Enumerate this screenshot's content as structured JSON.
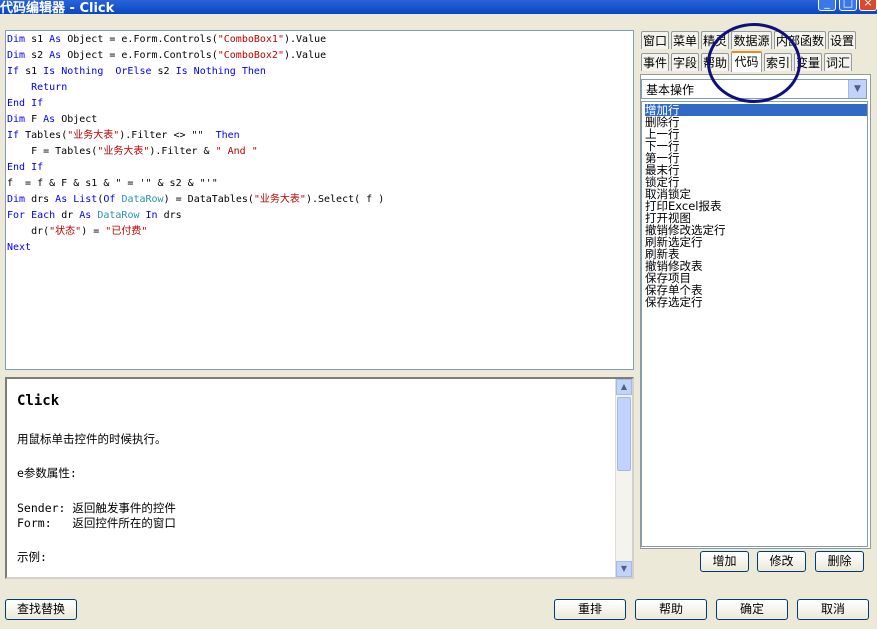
{
  "window": {
    "title": "代码编辑器 - Click",
    "min_glyph": "_",
    "max_glyph": "□",
    "close_glyph": "×"
  },
  "code_lines": [
    [
      {
        "t": "kw",
        "s": "Dim"
      },
      {
        "t": "tx",
        "s": " s1 "
      },
      {
        "t": "kw",
        "s": "As"
      },
      {
        "t": "tx",
        "s": " Object = e.Form.Controls("
      },
      {
        "t": "st",
        "s": "\"ComboBox1\""
      },
      {
        "t": "tx",
        "s": ").Value"
      }
    ],
    [
      {
        "t": "kw",
        "s": "Dim"
      },
      {
        "t": "tx",
        "s": " s2 "
      },
      {
        "t": "kw",
        "s": "As"
      },
      {
        "t": "tx",
        "s": " Object = e.Form.Controls("
      },
      {
        "t": "st",
        "s": "\"ComboBox2\""
      },
      {
        "t": "tx",
        "s": ").Value"
      }
    ],
    [
      {
        "t": "kw",
        "s": "If"
      },
      {
        "t": "tx",
        "s": " s1 "
      },
      {
        "t": "kw",
        "s": "Is Nothing  OrElse"
      },
      {
        "t": "tx",
        "s": " s2 "
      },
      {
        "t": "kw",
        "s": "Is Nothing Then"
      }
    ],
    [
      {
        "t": "tx",
        "s": "    "
      },
      {
        "t": "kw",
        "s": "Return"
      }
    ],
    [
      {
        "t": "kw",
        "s": "End If"
      }
    ],
    [
      {
        "t": "kw",
        "s": "Dim"
      },
      {
        "t": "tx",
        "s": " F "
      },
      {
        "t": "kw",
        "s": "As"
      },
      {
        "t": "tx",
        "s": " Object"
      }
    ],
    [
      {
        "t": "kw",
        "s": "If"
      },
      {
        "t": "tx",
        "s": " Tables("
      },
      {
        "t": "st",
        "s": "\"业务大表\""
      },
      {
        "t": "tx",
        "s": ").Filter <> \"\"  "
      },
      {
        "t": "kw",
        "s": "Then"
      }
    ],
    [
      {
        "t": "tx",
        "s": "    F = Tables("
      },
      {
        "t": "st",
        "s": "\"业务大表\""
      },
      {
        "t": "tx",
        "s": ").Filter & "
      },
      {
        "t": "st",
        "s": "\" And \""
      }
    ],
    [
      {
        "t": "kw",
        "s": "End If"
      }
    ],
    [
      {
        "t": "tx",
        "s": "f  = f & F & s1 & \" = '\" & s2 & \"'\""
      }
    ],
    [
      {
        "t": "kw",
        "s": "Dim"
      },
      {
        "t": "tx",
        "s": " drs "
      },
      {
        "t": "kw",
        "s": "As List"
      },
      {
        "t": "tx",
        "s": "("
      },
      {
        "t": "kw",
        "s": "Of"
      },
      {
        "t": "tx",
        "s": " "
      },
      {
        "t": "ty",
        "s": "DataRow"
      },
      {
        "t": "tx",
        "s": ") = DataTables("
      },
      {
        "t": "st",
        "s": "\"业务大表\""
      },
      {
        "t": "tx",
        "s": ").Select( f )"
      }
    ],
    [
      {
        "t": "kw",
        "s": "For Each"
      },
      {
        "t": "tx",
        "s": " dr "
      },
      {
        "t": "kw",
        "s": "As"
      },
      {
        "t": "tx",
        "s": " "
      },
      {
        "t": "ty",
        "s": "DataRow"
      },
      {
        "t": "tx",
        "s": " "
      },
      {
        "t": "kw",
        "s": "In"
      },
      {
        "t": "tx",
        "s": " drs"
      }
    ],
    [
      {
        "t": "tx",
        "s": "    dr("
      },
      {
        "t": "st",
        "s": "\"状态\""
      },
      {
        "t": "tx",
        "s": ") = "
      },
      {
        "t": "st",
        "s": "\"已付费\""
      }
    ],
    [
      {
        "t": "kw",
        "s": "Next"
      }
    ]
  ],
  "help": {
    "title": "Click",
    "lines": [
      "用鼠标单击控件的时候执行。",
      "",
      "e参数属性:",
      "",
      "Sender: 返回触发事件的控件",
      "Form:   返回控件所在的窗口",
      "",
      "示例:"
    ],
    "scroll_up": "▲",
    "scroll_down": "▼"
  },
  "tabs": {
    "row1": [
      "窗口",
      "菜单",
      "精灵",
      "数据源",
      "内部函数",
      "设置"
    ],
    "row2": [
      "事件",
      "字段",
      "帮助",
      "代码",
      "索引",
      "变量",
      "词汇"
    ],
    "active": "代码"
  },
  "combo": {
    "value": "基本操作",
    "arrow": "▼"
  },
  "operations": [
    "增加行",
    "删除行",
    "上一行",
    "下一行",
    "第一行",
    "最末行",
    "锁定行",
    "取消锁定",
    "打印Excel报表",
    "打开视图",
    "撤销修改选定行",
    "刷新选定行",
    "刷新表",
    "撤销修改表",
    "保存项目",
    "保存单个表",
    "保存选定行"
  ],
  "selected_operation": "增加行",
  "buttons": {
    "add": "增加",
    "edit": "修改",
    "delete": "删除",
    "find_replace": "查找替换",
    "rearrange": "重排",
    "help": "帮助",
    "ok": "确定",
    "cancel": "取消"
  }
}
